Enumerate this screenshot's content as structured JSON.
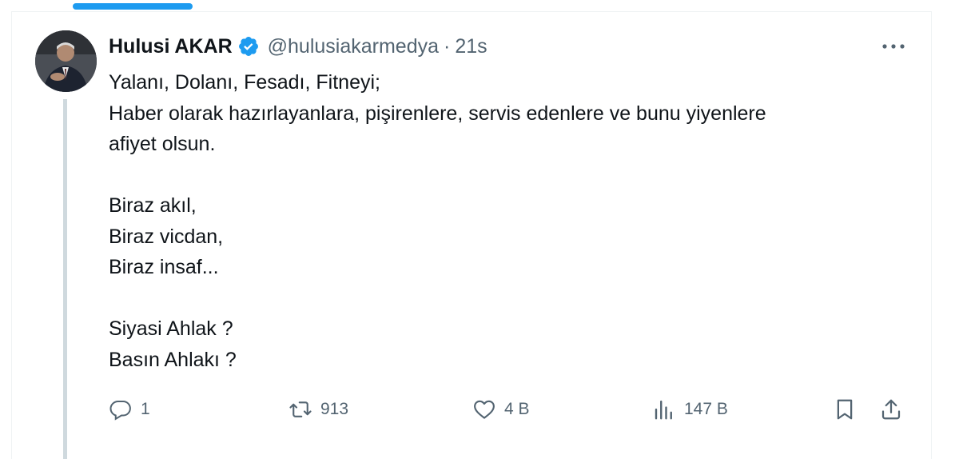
{
  "tweet": {
    "author_name": "Hulusi AKAR",
    "handle": "@hulusiakarmedya",
    "separator": "·",
    "time": "21s",
    "lines": [
      "Yalanı, Dolanı, Fesadı, Fitneyi;",
      "Haber olarak hazırlayanlara, pişirenlere, servis edenlere ve bunu yiyenlere",
      "afiyet olsun.",
      "",
      "Biraz akıl,",
      "Biraz vicdan,",
      "Biraz insaf...",
      "",
      "Siyasi Ahlak ?",
      "Basın Ahlakı ?"
    ]
  },
  "actions": {
    "replies": "1",
    "reposts": "913",
    "likes": "4 B",
    "views": "147 B"
  },
  "icons": [
    "verified-badge-icon",
    "more-icon",
    "reply-icon",
    "repost-icon",
    "like-icon",
    "views-icon",
    "bookmark-icon",
    "share-icon"
  ],
  "colors": {
    "accent": "#1d9bf0",
    "secondary_text": "#536471",
    "thread_line": "#cfd9de"
  }
}
